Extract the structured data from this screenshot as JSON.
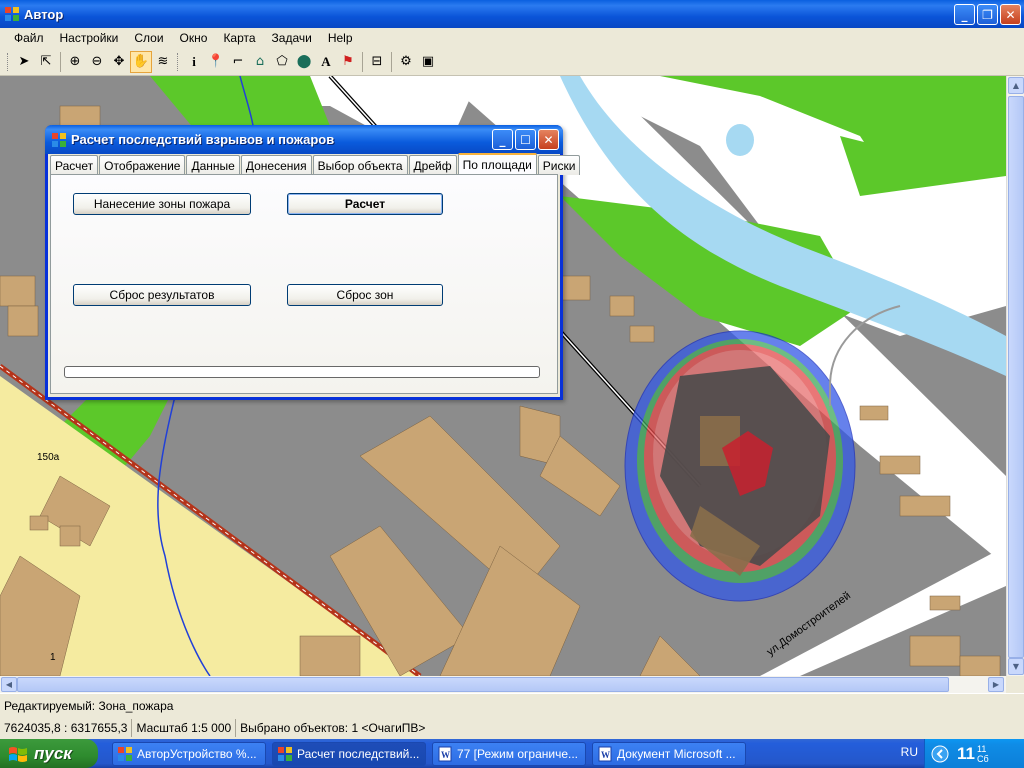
{
  "app": {
    "title": "Автор"
  },
  "menu": [
    "Файл",
    "Настройки",
    "Слои",
    "Окно",
    "Карта",
    "Задачи",
    "Help"
  ],
  "dialog": {
    "title": "Расчет последствий взрывов и пожаров",
    "tabs": [
      "Расчет",
      "Отображение",
      "Данные",
      "Донесения",
      "Выбор объекта",
      "Дрейф",
      "По площади",
      "Риски"
    ],
    "active_tab": "По площади",
    "buttons": {
      "draw_fire_zone": "Нанесение зоны пожара",
      "calculate": "Расчет",
      "reset_results": "Сброс результатов",
      "reset_zones": "Сброс зон"
    },
    "progress": 0
  },
  "map": {
    "labels": {
      "house_150a": "150а",
      "house_1": "1",
      "street": "ул.Домостроителей"
    },
    "colors": {
      "road": "#8C8C8C",
      "building": "#C9A574",
      "park": "#5CC82A",
      "water": "#A6D9F2",
      "yellow_zone": "#F5EBA0",
      "rail": "#B5341A"
    }
  },
  "status": {
    "editable": "Редактируемый: Зона_пожара",
    "coords": "7624035,8 : 6317655,3",
    "scale": "Масштаб 1:5 000",
    "selected": "Выбрано объектов: 1 <ОчагиПВ>"
  },
  "taskbar": {
    "start": "пуск",
    "tasks": [
      "АвторУстройство %...",
      "Расчет последствий...",
      "77 [Режим ограниче...",
      "Документ Microsoft ..."
    ],
    "lang": "RU",
    "clock_hour": "11",
    "clock_min": "11",
    "clock_day": "Сб"
  }
}
